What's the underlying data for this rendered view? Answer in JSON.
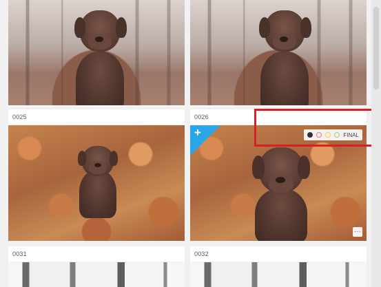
{
  "gallery": {
    "items": [
      {
        "id": "top-left",
        "label": ""
      },
      {
        "id": "top-right",
        "label": ""
      },
      {
        "id": "mid-left",
        "label": "0025"
      },
      {
        "id": "mid-right",
        "label": "0026"
      },
      {
        "id": "bottom-left",
        "label": "0031"
      },
      {
        "id": "bottom-right",
        "label": "0032"
      }
    ],
    "overlay": {
      "add_symbol": "+",
      "rating_label": "FINAL",
      "more_symbol": "···"
    }
  }
}
